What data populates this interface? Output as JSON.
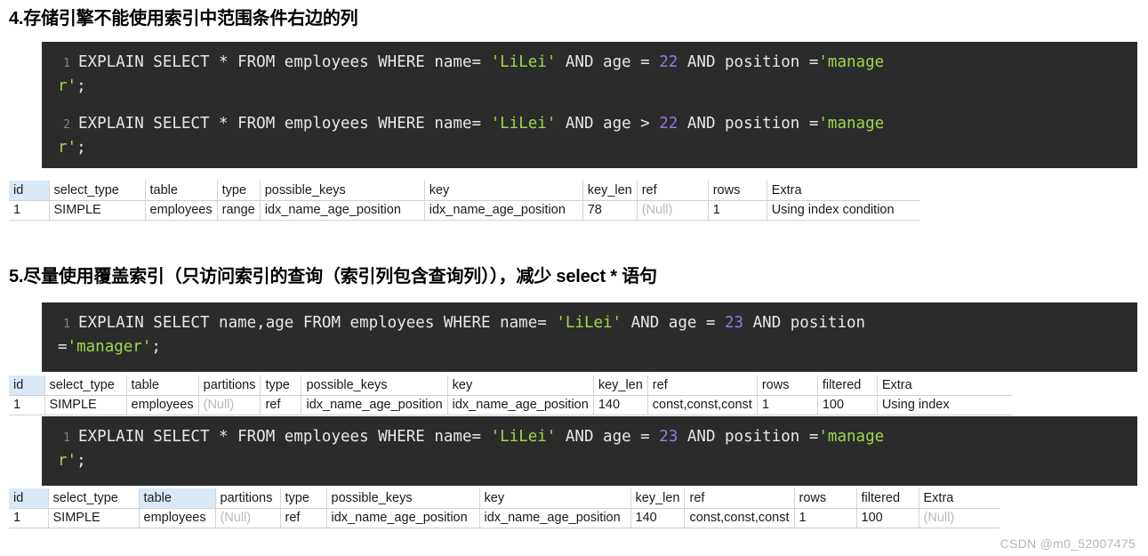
{
  "sections": [
    {
      "heading": "4.存储引擎不能使用索引中范围条件右边的列",
      "code": {
        "lines": [
          {
            "number": "1",
            "parts": [
              {
                "t": "EXPLAIN SELECT * FROM employees WHERE name= ",
                "c": "plain"
              },
              {
                "t": "'LiLei'",
                "c": "str"
              },
              {
                "t": " AND age = ",
                "c": "plain"
              },
              {
                "t": "22",
                "c": "num"
              },
              {
                "t": " AND position =",
                "c": "plain"
              },
              {
                "t": "'manage",
                "c": "str"
              }
            ],
            "wrap": [
              {
                "t": "r'",
                "c": "str"
              },
              {
                "t": ";",
                "c": "plain"
              }
            ]
          },
          {
            "number": "2",
            "parts": [
              {
                "t": "EXPLAIN SELECT * FROM employees WHERE name= ",
                "c": "plain"
              },
              {
                "t": "'LiLei'",
                "c": "str"
              },
              {
                "t": " AND age > ",
                "c": "plain"
              },
              {
                "t": "22",
                "c": "num"
              },
              {
                "t": " AND position =",
                "c": "plain"
              },
              {
                "t": "'manage",
                "c": "str"
              }
            ],
            "wrap": [
              {
                "t": "r'",
                "c": "str"
              },
              {
                "t": ";",
                "c": "plain"
              }
            ]
          }
        ]
      }
    },
    {
      "heading": "5.尽量使用覆盖索引（只访问索引的查询（索引列包含查询列）），减少 select * 语句",
      "code": {
        "lines": [
          {
            "number": "1",
            "parts": [
              {
                "t": "EXPLAIN SELECT name,age FROM employees WHERE name= ",
                "c": "plain"
              },
              {
                "t": "'LiLei'",
                "c": "str"
              },
              {
                "t": " AND age = ",
                "c": "plain"
              },
              {
                "t": "23",
                "c": "num"
              },
              {
                "t": " AND position",
                "c": "plain"
              }
            ],
            "wrap": [
              {
                "t": "=",
                "c": "plain"
              },
              {
                "t": "'manager'",
                "c": "str"
              },
              {
                "t": ";",
                "c": "plain"
              }
            ]
          }
        ]
      },
      "code2": {
        "lines": [
          {
            "number": "1",
            "parts": [
              {
                "t": "EXPLAIN SELECT * FROM employees WHERE name= ",
                "c": "plain"
              },
              {
                "t": "'LiLei'",
                "c": "str"
              },
              {
                "t": " AND age = ",
                "c": "plain"
              },
              {
                "t": "23",
                "c": "num"
              },
              {
                "t": " AND position =",
                "c": "plain"
              },
              {
                "t": "'manage",
                "c": "str"
              }
            ],
            "wrap": [
              {
                "t": "r'",
                "c": "str"
              },
              {
                "t": ";",
                "c": "plain"
              }
            ]
          }
        ]
      }
    }
  ],
  "tables": [
    {
      "name": "explain-result-1",
      "columns": [
        "id",
        "select_type",
        "table",
        "type",
        "possible_keys",
        "key",
        "key_len",
        "ref",
        "rows",
        "Extra"
      ],
      "header_highlight": [
        true,
        false,
        false,
        false,
        false,
        false,
        false,
        false,
        false,
        false
      ],
      "widths": [
        45,
        108,
        75,
        48,
        185,
        178,
        58,
        80,
        66,
        172
      ],
      "rows": [
        {
          "cells": [
            "1",
            "SIMPLE",
            "employees",
            "range",
            "idx_name_age_position",
            "idx_name_age_position",
            "78",
            "(Null)",
            "1",
            "Using index condition"
          ],
          "null_flags": [
            false,
            false,
            false,
            false,
            false,
            false,
            false,
            true,
            false,
            false
          ],
          "align": [
            "left",
            "left",
            "left",
            "left",
            "left",
            "left",
            "left",
            "left",
            "left",
            "left"
          ]
        }
      ]
    },
    {
      "name": "explain-result-2",
      "columns": [
        "id",
        "select_type",
        "table",
        "partitions",
        "type",
        "possible_keys",
        "key",
        "key_len",
        "ref",
        "rows",
        "filtered",
        "Extra"
      ],
      "header_highlight": [
        true,
        false,
        false,
        false,
        false,
        false,
        false,
        false,
        false,
        false,
        false,
        false
      ],
      "widths": [
        40,
        92,
        77,
        68,
        46,
        163,
        153,
        52,
        102,
        68,
        67,
        152
      ],
      "rows": [
        {
          "cells": [
            "1",
            "SIMPLE",
            "employees",
            "(Null)",
            "ref",
            "idx_name_age_position",
            "idx_name_age_position",
            "140",
            "const,const,const",
            "1",
            "100",
            "Using index"
          ],
          "null_flags": [
            false,
            false,
            false,
            true,
            false,
            false,
            false,
            false,
            false,
            false,
            false,
            false
          ],
          "align": [
            "left",
            "left",
            "left",
            "left",
            "left",
            "left",
            "left",
            "left",
            "left",
            "left",
            "right",
            "left"
          ]
        }
      ]
    },
    {
      "name": "explain-result-3",
      "columns": [
        "id",
        "select_type",
        "table",
        "partitions",
        "type",
        "possible_keys",
        "key",
        "key_len",
        "ref",
        "rows",
        "filtered",
        "Extra"
      ],
      "header_highlight": [
        true,
        false,
        true,
        false,
        false,
        false,
        false,
        false,
        false,
        false,
        false,
        false
      ],
      "widths": [
        44,
        102,
        86,
        73,
        52,
        172,
        170,
        56,
        110,
        70,
        70,
        91
      ],
      "rows": [
        {
          "cells": [
            "1",
            "SIMPLE",
            "employees",
            "(Null)",
            "ref",
            "idx_name_age_position",
            "idx_name_age_position",
            "140",
            "const,const,const",
            "1",
            "100",
            "(Null)"
          ],
          "null_flags": [
            false,
            false,
            false,
            true,
            false,
            false,
            false,
            false,
            false,
            false,
            false,
            true
          ],
          "align": [
            "left",
            "left",
            "left",
            "left",
            "left",
            "left",
            "left",
            "left",
            "left",
            "left",
            "right",
            "left"
          ]
        }
      ]
    }
  ],
  "watermark": "CSDN @m0_52007475",
  "colors": {
    "code_background": "#2b2b2b",
    "string_token": "#9fd74a",
    "number_token": "#9a77e0",
    "header_highlight": "#dbe9f7",
    "null_text": "#b9b9b9"
  }
}
